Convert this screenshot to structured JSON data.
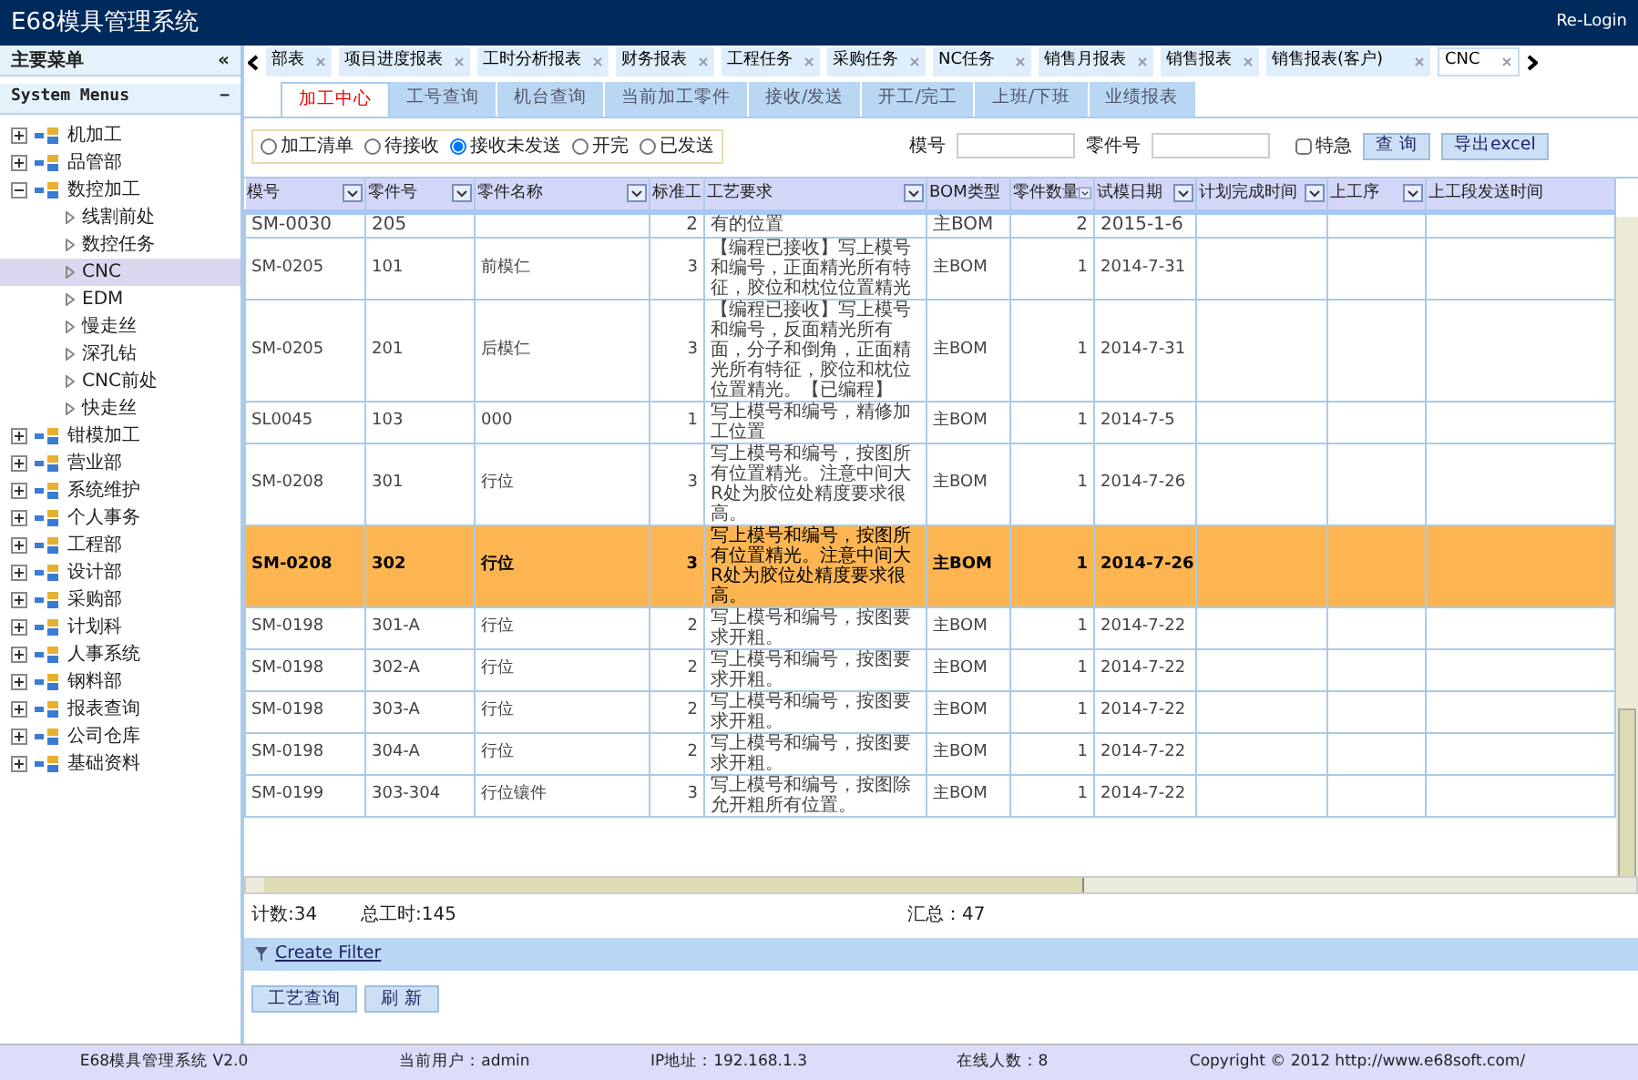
{
  "window": {
    "title": "E68模具管理系统",
    "relogin": "Re-Login"
  },
  "sidebar": {
    "title": "主要菜单",
    "collapse": "«",
    "section": "System Menus",
    "section_toggle": "−",
    "items": [
      {
        "label": "机加工",
        "expanded": false,
        "selected": false
      },
      {
        "label": "品管部",
        "expanded": false,
        "selected": false
      },
      {
        "label": "数控加工",
        "expanded": true,
        "selected": false,
        "children": [
          {
            "label": "线割前处",
            "selected": false
          },
          {
            "label": "数控任务",
            "selected": false
          },
          {
            "label": "CNC",
            "selected": true
          },
          {
            "label": "EDM",
            "selected": false
          },
          {
            "label": "慢走丝",
            "selected": false
          },
          {
            "label": "深孔钻",
            "selected": false
          },
          {
            "label": "CNC前处",
            "selected": false
          },
          {
            "label": "快走丝",
            "selected": false
          }
        ]
      },
      {
        "label": "钳模加工",
        "expanded": false,
        "selected": false
      },
      {
        "label": "营业部",
        "expanded": false,
        "selected": false
      },
      {
        "label": "系统维护",
        "expanded": false,
        "selected": false
      },
      {
        "label": "个人事务",
        "expanded": false,
        "selected": false
      },
      {
        "label": "工程部",
        "expanded": false,
        "selected": false
      },
      {
        "label": "设计部",
        "expanded": false,
        "selected": false
      },
      {
        "label": "采购部",
        "expanded": false,
        "selected": false
      },
      {
        "label": "计划科",
        "expanded": false,
        "selected": false
      },
      {
        "label": "人事系统",
        "expanded": false,
        "selected": false
      },
      {
        "label": "钢料部",
        "expanded": false,
        "selected": false
      },
      {
        "label": "报表查询",
        "expanded": false,
        "selected": false
      },
      {
        "label": "公司仓库",
        "expanded": false,
        "selected": false
      },
      {
        "label": "基础资料",
        "expanded": false,
        "selected": false
      }
    ]
  },
  "tabs": [
    {
      "label": "部表",
      "selected": false
    },
    {
      "label": "项目进度报表",
      "selected": false
    },
    {
      "label": "工时分析报表",
      "selected": false
    },
    {
      "label": "财务报表",
      "selected": false
    },
    {
      "label": "工程任务",
      "selected": false
    },
    {
      "label": "采购任务",
      "selected": false
    },
    {
      "label": "NC任务",
      "selected": false
    },
    {
      "label": "销售月报表",
      "selected": false
    },
    {
      "label": "销售报表",
      "selected": false
    },
    {
      "label": "销售报表(客户)",
      "selected": false
    },
    {
      "label": "CNC",
      "selected": true
    }
  ],
  "subtabs": [
    {
      "label": "加工中心",
      "selected": true
    },
    {
      "label": "工号查询",
      "selected": false
    },
    {
      "label": "机台查询",
      "selected": false
    },
    {
      "label": "当前加工零件",
      "selected": false
    },
    {
      "label": "接收/发送",
      "selected": false
    },
    {
      "label": "开工/完工",
      "selected": false
    },
    {
      "label": "上班/下班",
      "selected": false
    },
    {
      "label": "业绩报表",
      "selected": false
    }
  ],
  "filters": {
    "radios": [
      {
        "label": "加工清单",
        "selected": false
      },
      {
        "label": "待接收",
        "selected": false
      },
      {
        "label": "接收未发送",
        "selected": true
      },
      {
        "label": "开完",
        "selected": false
      },
      {
        "label": "已发送",
        "selected": false
      }
    ],
    "mold_label": "模号",
    "part_label": "零件号",
    "urgent_label": "特急",
    "urgent_checked": false,
    "search_button": "查 询",
    "export_button": "导出excel"
  },
  "table": {
    "columns": [
      "模号",
      "零件号",
      "零件名称",
      "标准工",
      "工艺要求",
      "BOM类型",
      "零件数量",
      "试模日期",
      "计划完成时间",
      "上工序",
      "上工段发送时间"
    ],
    "rows": [
      {
        "cells": [
          "SM-0030",
          "205",
          "",
          "2",
          "有的位置",
          "主BOM",
          "2",
          "2015-1-6"
        ],
        "selected": false,
        "partial": true
      },
      {
        "cells": [
          "SM-0205",
          "101",
          "前模仁",
          "3",
          "【编程已接收】写上模号和编号，正面精光所有特征，胶位和枕位位置精光",
          "主BOM",
          "1",
          "2014-7-31"
        ],
        "selected": false
      },
      {
        "cells": [
          "SM-0205",
          "201",
          "后模仁",
          "3",
          "【编程已接收】写上模号和编号，反面精光所有面，分子和倒角，正面精光所有特征，胶位和枕位位置精光。【已编程】",
          "主BOM",
          "1",
          "2014-7-31"
        ],
        "selected": false
      },
      {
        "cells": [
          "SL0045",
          "103",
          "000",
          "1",
          "写上模号和编号，精修加工位置",
          "主BOM",
          "1",
          "2014-7-5"
        ],
        "selected": false
      },
      {
        "cells": [
          "SM-0208",
          "301",
          "行位",
          "3",
          "写上模号和编号，按图所有位置精光。注意中间大R处为胶位处精度要求很高。",
          "主BOM",
          "1",
          "2014-7-26"
        ],
        "selected": false
      },
      {
        "cells": [
          "SM-0208",
          "302",
          "行位",
          "3",
          "写上模号和编号，按图所有位置精光。注意中间大R处为胶位处精度要求很高。",
          "主BOM",
          "1",
          "2014-7-26"
        ],
        "selected": true
      },
      {
        "cells": [
          "SM-0198",
          "301-A",
          "行位",
          "2",
          "写上模号和编号，按图要求开粗。",
          "主BOM",
          "1",
          "2014-7-22"
        ],
        "selected": false
      },
      {
        "cells": [
          "SM-0198",
          "302-A",
          "行位",
          "2",
          "写上模号和编号，按图要求开粗。",
          "主BOM",
          "1",
          "2014-7-22"
        ],
        "selected": false
      },
      {
        "cells": [
          "SM-0198",
          "303-A",
          "行位",
          "2",
          "写上模号和编号，按图要求开粗。",
          "主BOM",
          "1",
          "2014-7-22"
        ],
        "selected": false
      },
      {
        "cells": [
          "SM-0198",
          "304-A",
          "行位",
          "2",
          "写上模号和编号，按图要求开粗。",
          "主BOM",
          "1",
          "2014-7-22"
        ],
        "selected": false
      },
      {
        "cells": [
          "SM-0199",
          "303-304",
          "行位镶件",
          "3",
          "写上模号和编号，按图除允开粗所有位置。",
          "主BOM",
          "1",
          "2014-7-22"
        ],
        "selected": false
      }
    ],
    "count": "计数:34",
    "total_hours": "总工时:145",
    "summary": "汇总：47"
  },
  "create_filter": "Create Filter",
  "buttons": [
    "工艺查询",
    "刷 新"
  ],
  "status_bar": [
    "E68模具管理系统 V2.0",
    "当前用户：admin",
    "IP地址：192.168.1.3",
    "在线人数：8",
    "Copyright © 2012 http://www.e68soft.com/"
  ]
}
